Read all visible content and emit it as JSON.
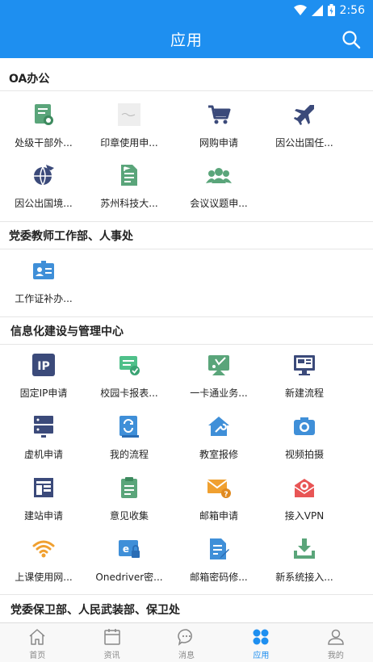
{
  "status_bar": {
    "time": "2:56"
  },
  "app_bar": {
    "title": "应用"
  },
  "sections": [
    {
      "title": "OA办公",
      "items": [
        {
          "label": "处级干部外...",
          "icon": "certificate-icon"
        },
        {
          "label": "印章使用申...",
          "icon": "seal-image-icon"
        },
        {
          "label": "网购申请",
          "icon": "shopping-cart-icon"
        },
        {
          "label": "因公出国任...",
          "icon": "airplane-icon"
        },
        {
          "label": "因公出国境...",
          "icon": "globe-plane-icon"
        },
        {
          "label": "苏州科技大...",
          "icon": "document-flag-icon"
        },
        {
          "label": "会议议题申...",
          "icon": "people-group-icon"
        }
      ]
    },
    {
      "title": "党委教师工作部、人事处",
      "items": [
        {
          "label": "工作证补办...",
          "icon": "id-card-icon"
        }
      ]
    },
    {
      "title": "信息化建设与管理中心",
      "items": [
        {
          "label": "固定IP申请",
          "icon": "ip-icon"
        },
        {
          "label": "校园卡报表...",
          "icon": "campus-card-icon"
        },
        {
          "label": "一卡通业务...",
          "icon": "card-service-icon"
        },
        {
          "label": "新建流程",
          "icon": "monitor-icon"
        },
        {
          "label": "虚机申请",
          "icon": "server-icon"
        },
        {
          "label": "我的流程",
          "icon": "refresh-book-icon"
        },
        {
          "label": "教室报修",
          "icon": "house-wrench-icon"
        },
        {
          "label": "视频拍摄",
          "icon": "camera-icon"
        },
        {
          "label": "建站申请",
          "icon": "website-layout-icon"
        },
        {
          "label": "意见收集",
          "icon": "clipboard-icon"
        },
        {
          "label": "邮箱申请",
          "icon": "mail-help-icon"
        },
        {
          "label": "接入VPN",
          "icon": "vpn-mail-icon"
        },
        {
          "label": "上课使用网...",
          "icon": "wifi-icon"
        },
        {
          "label": "Onedriver密...",
          "icon": "onedrive-lock-icon"
        },
        {
          "label": "邮箱密码修...",
          "icon": "doc-edit-icon"
        },
        {
          "label": "新系统接入...",
          "icon": "download-tray-icon"
        }
      ]
    },
    {
      "title": "党委保卫部、人民武装部、保卫处",
      "items": []
    }
  ],
  "tabs": [
    {
      "label": "首页",
      "icon": "home-icon",
      "active": false
    },
    {
      "label": "资讯",
      "icon": "calendar-icon",
      "active": false
    },
    {
      "label": "消息",
      "icon": "chat-icon",
      "active": false
    },
    {
      "label": "应用",
      "icon": "apps-grid-icon",
      "active": true
    },
    {
      "label": "我的",
      "icon": "person-icon",
      "active": false
    }
  ],
  "colors": {
    "primary": "#1e8ff0",
    "navy": "#3b4a7a",
    "green": "#4aa86b",
    "orange": "#f0a030",
    "red": "#e85555"
  }
}
